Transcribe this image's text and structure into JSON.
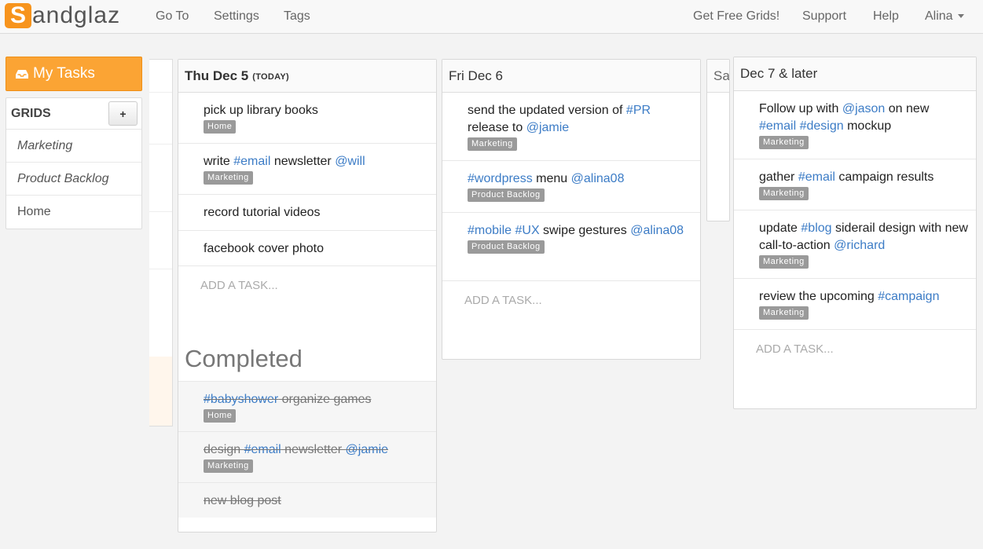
{
  "nav": {
    "logo_initial": "S",
    "logo_rest": "andglaz",
    "goto": "Go To",
    "settings": "Settings",
    "tags": "Tags",
    "free_grids": "Get Free Grids!",
    "support": "Support",
    "help": "Help",
    "user": "Alina"
  },
  "sidebar": {
    "my_tasks": "My Tasks",
    "grids_label": "GRIDS",
    "add_label": "+",
    "items": [
      {
        "label": "Marketing"
      },
      {
        "label": "Product Backlog"
      },
      {
        "label": "Home"
      }
    ]
  },
  "columns": {
    "thu": {
      "title": "Thu Dec 5",
      "today": "(TODAY)",
      "tasks": [
        {
          "text": "pick up library books",
          "badge": "Home"
        },
        {
          "pre": "write ",
          "tag": "#email",
          "mid": " newsletter ",
          "mention": "@will",
          "badge": "Marketing"
        },
        {
          "text": "record tutorial videos"
        },
        {
          "text": "facebook cover photo"
        }
      ],
      "add_task": "ADD A TASK...",
      "completed_title": "Completed",
      "completed": [
        {
          "tag": "#babyshower",
          "text": " organize games",
          "badge": "Home"
        },
        {
          "pre": "design ",
          "tag": "#email",
          "mid": " newsletter ",
          "mention": "@jamie",
          "badge": "Marketing"
        },
        {
          "text": "new blog post"
        }
      ]
    },
    "fri": {
      "title": "Fri Dec 6",
      "tasks": [
        {
          "pre": "send the updated version of ",
          "tag": "#PR",
          "mid": " release to ",
          "mention": "@jamie",
          "badge": "Marketing"
        },
        {
          "tag": "#wordpress",
          "mid": " menu ",
          "mention": "@alina08",
          "badge": "Product Backlog"
        },
        {
          "tag": "#mobile",
          "tag2": "#UX",
          "mid": " swipe gestures ",
          "mention": "@alina08",
          "badge": "Product Backlog"
        }
      ],
      "add_task": "ADD A TASK..."
    },
    "sat": {
      "title": "Sa"
    },
    "later": {
      "title": "Dec 7 & later",
      "tasks": [
        {
          "pre": "Follow up with ",
          "mention": "@jason",
          "mid": " on new ",
          "tag": "#email",
          "tag2": "#design",
          "post": " mockup",
          "badge": "Marketing"
        },
        {
          "pre": "gather ",
          "tag": "#email",
          "mid": " campaign results",
          "badge": "Marketing"
        },
        {
          "pre": "update ",
          "tag": "#blog",
          "mid": " siderail design with new call-to-action ",
          "mention": "@richard",
          "badge": "Marketing"
        },
        {
          "pre": "review the upcoming ",
          "tag": "#campaign",
          "badge": "Marketing"
        }
      ],
      "add_task": "ADD A TASK..."
    }
  }
}
